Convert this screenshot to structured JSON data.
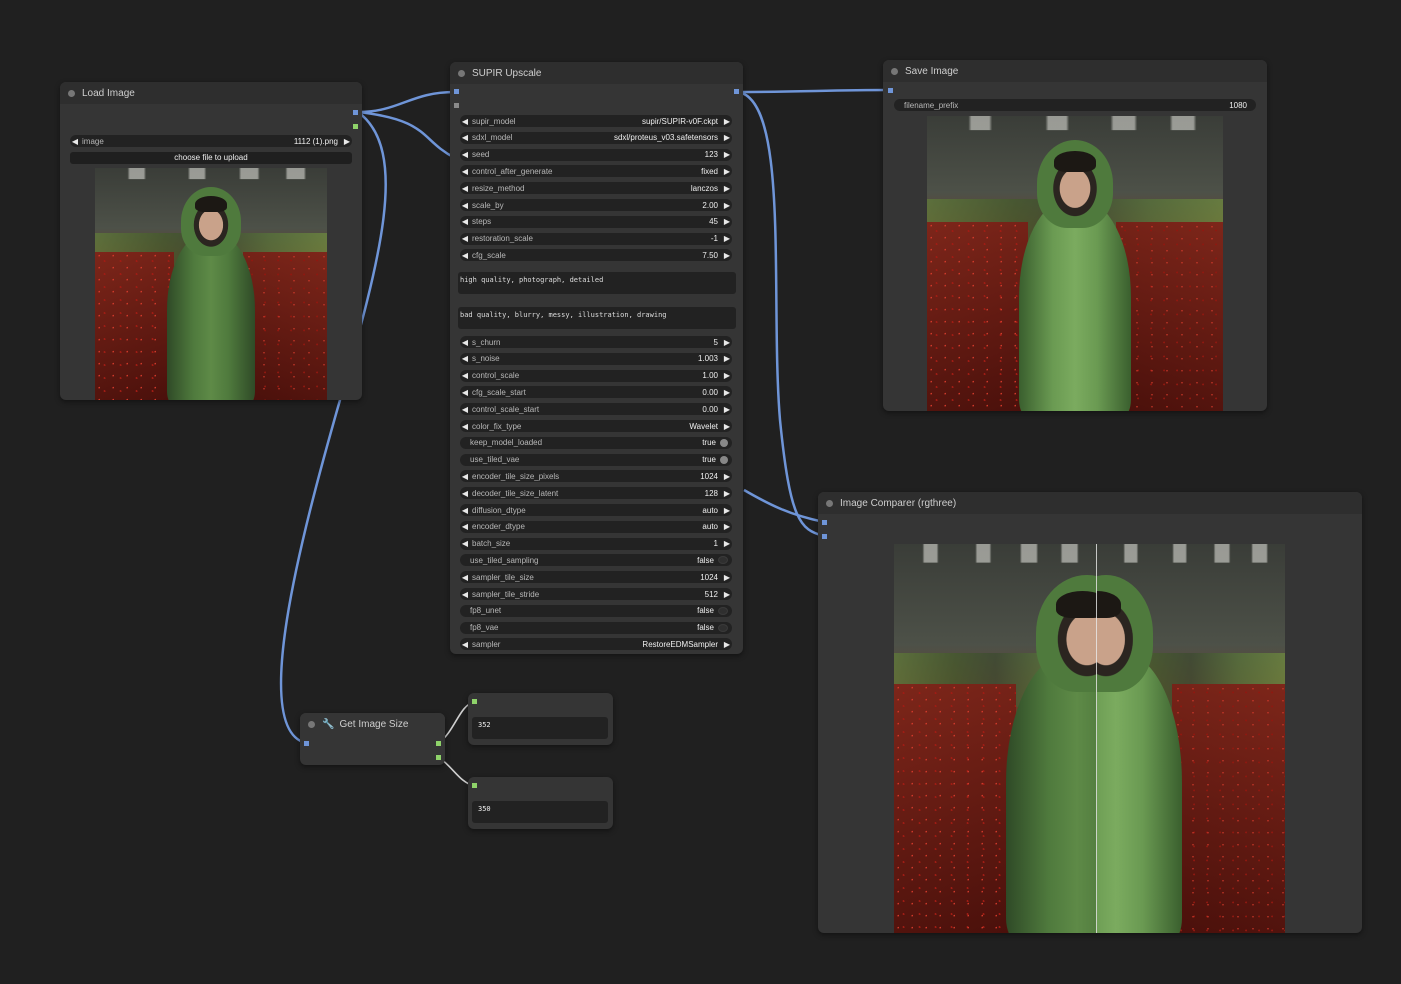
{
  "nodes": {
    "load_image": {
      "title": "Load Image",
      "image_widget": {
        "name": "image",
        "value": "1112 (1).png"
      },
      "upload_button": "choose file to upload"
    },
    "supir": {
      "title": "SUPIR Upscale",
      "widgets_top": [
        {
          "name": "supir_model",
          "value": "supir/SUPIR-v0F.ckpt"
        },
        {
          "name": "sdxl_model",
          "value": "sdxl/proteus_v03.safetensors"
        },
        {
          "name": "seed",
          "value": "123"
        },
        {
          "name": "control_after_generate",
          "value": "fixed"
        },
        {
          "name": "resize_method",
          "value": "lanczos"
        },
        {
          "name": "scale_by",
          "value": "2.00"
        },
        {
          "name": "steps",
          "value": "45"
        },
        {
          "name": "restoration_scale",
          "value": "-1"
        },
        {
          "name": "cfg_scale",
          "value": "7.50"
        }
      ],
      "positive_prompt": "high quality, photograph, detailed",
      "negative_prompt": "bad quality, blurry, messy, illustration, drawing",
      "widgets_bottom": [
        {
          "name": "s_churn",
          "value": "5",
          "type": "number"
        },
        {
          "name": "s_noise",
          "value": "1.003",
          "type": "number"
        },
        {
          "name": "control_scale",
          "value": "1.00",
          "type": "number"
        },
        {
          "name": "cfg_scale_start",
          "value": "0.00",
          "type": "number"
        },
        {
          "name": "control_scale_start",
          "value": "0.00",
          "type": "number"
        },
        {
          "name": "color_fix_type",
          "value": "Wavelet",
          "type": "number"
        },
        {
          "name": "keep_model_loaded",
          "value": "true",
          "type": "bool"
        },
        {
          "name": "use_tiled_vae",
          "value": "true",
          "type": "bool"
        },
        {
          "name": "encoder_tile_size_pixels",
          "value": "1024",
          "type": "number"
        },
        {
          "name": "decoder_tile_size_latent",
          "value": "128",
          "type": "number"
        },
        {
          "name": "diffusion_dtype",
          "value": "auto",
          "type": "number"
        },
        {
          "name": "encoder_dtype",
          "value": "auto",
          "type": "number"
        },
        {
          "name": "batch_size",
          "value": "1",
          "type": "number"
        },
        {
          "name": "use_tiled_sampling",
          "value": "false",
          "type": "bool"
        },
        {
          "name": "sampler_tile_size",
          "value": "1024",
          "type": "number"
        },
        {
          "name": "sampler_tile_stride",
          "value": "512",
          "type": "number"
        },
        {
          "name": "fp8_unet",
          "value": "false",
          "type": "bool"
        },
        {
          "name": "fp8_vae",
          "value": "false",
          "type": "bool"
        },
        {
          "name": "sampler",
          "value": "RestoreEDMSampler",
          "type": "number"
        }
      ]
    },
    "save_image": {
      "title": "Save Image",
      "filename_prefix": {
        "name": "filename_prefix",
        "value": "1080"
      }
    },
    "comparer": {
      "title": "Image Comparer (rgthree)"
    },
    "get_size": {
      "title": "Get Image Size"
    },
    "out_width": {
      "value": "352"
    },
    "out_height": {
      "value": "350"
    }
  },
  "colors": {
    "canvas": "#202020",
    "node": "#353535",
    "image_link": "#6f95d8",
    "int_link": "#8fd36a"
  }
}
